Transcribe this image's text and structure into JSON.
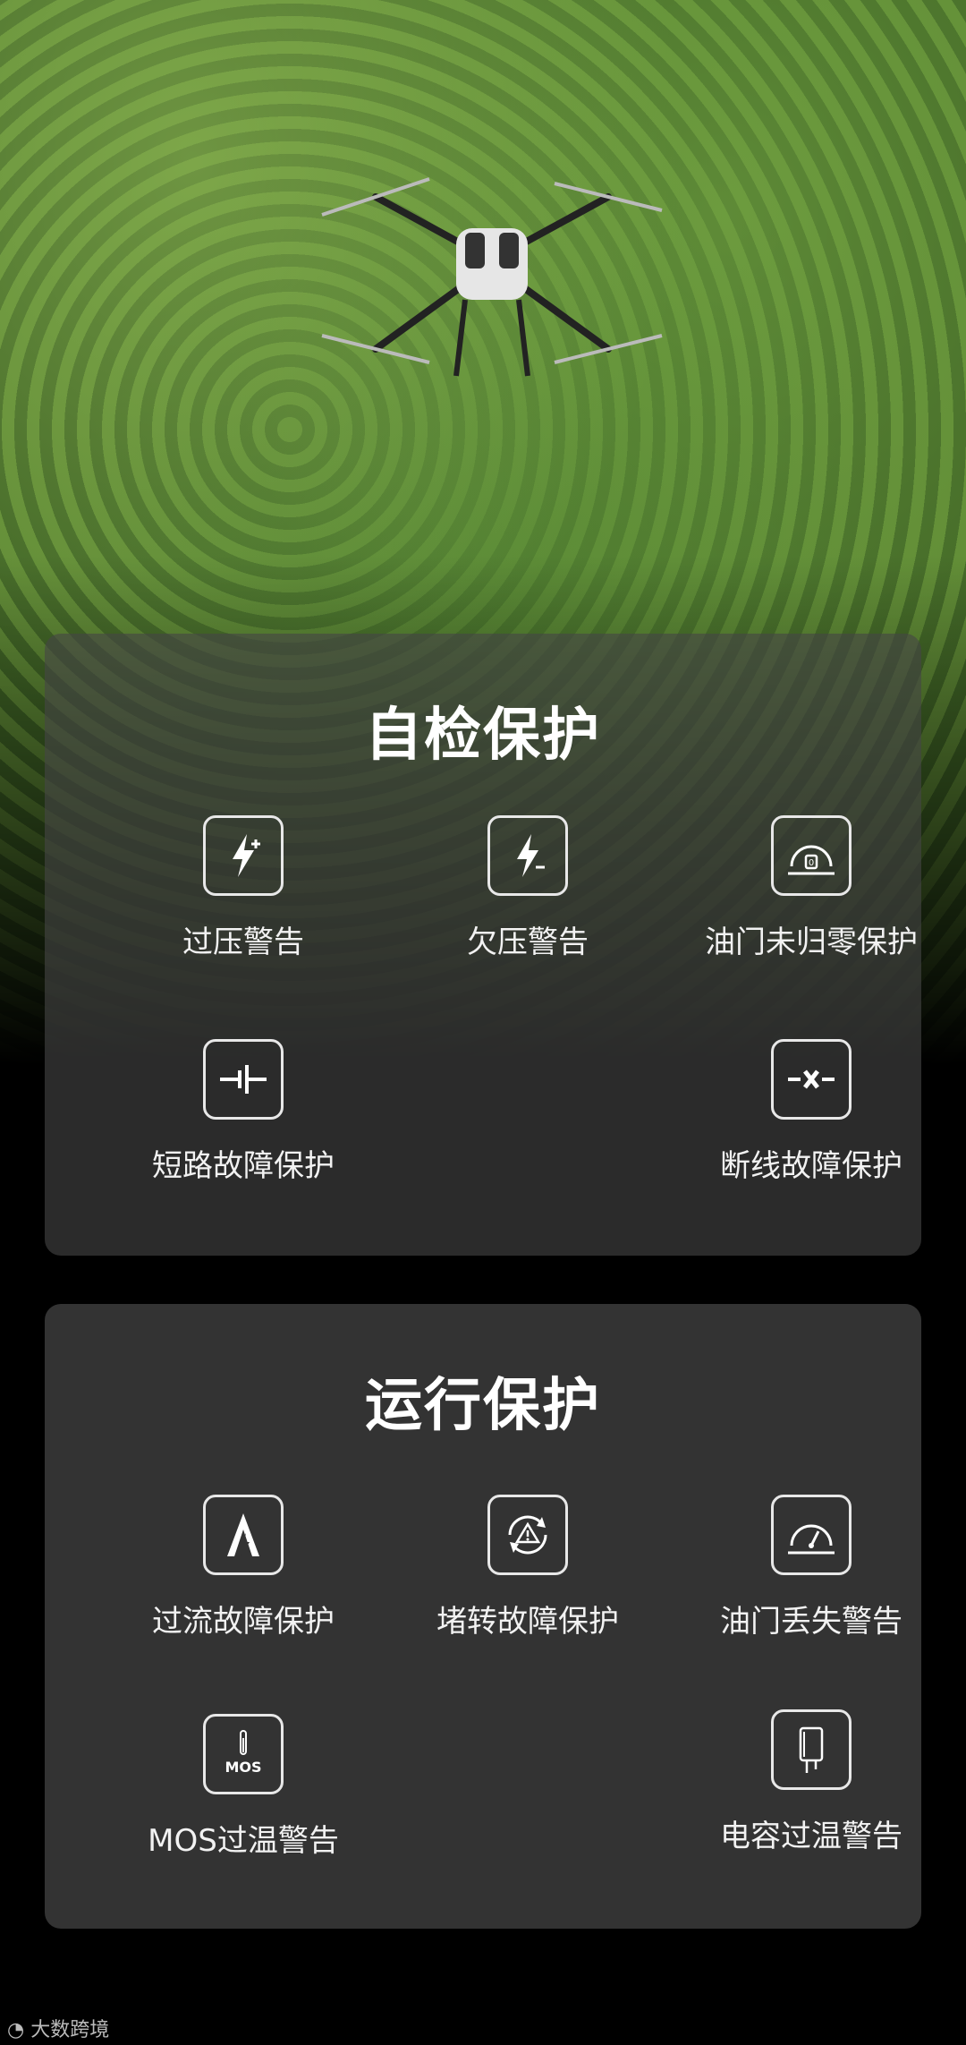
{
  "self_check": {
    "title": "自检保护",
    "items": [
      {
        "label": "过压警告",
        "icon": "lightning-plus-icon"
      },
      {
        "label": "欠压警告",
        "icon": "lightning-icon"
      },
      {
        "label": "油门未归零保护",
        "icon": "throttle-zero-gauge-icon"
      },
      {
        "label": "短路故障保护",
        "icon": "short-circuit-icon"
      },
      {
        "label": "断线故障保护",
        "icon": "broken-wire-icon"
      }
    ]
  },
  "runtime": {
    "title": "运行保护",
    "items": [
      {
        "label": "过流故障保护",
        "icon": "overcurrent-icon"
      },
      {
        "label": "堵转故障保护",
        "icon": "stall-warning-icon"
      },
      {
        "label": "油门丢失警告",
        "icon": "throttle-gauge-icon"
      },
      {
        "label": "MOS过温警告",
        "icon": "mos-thermometer-icon",
        "icon_text": "MOS"
      },
      {
        "label": "电容过温警告",
        "icon": "capacitor-icon"
      }
    ]
  },
  "watermark": "大数跨境"
}
